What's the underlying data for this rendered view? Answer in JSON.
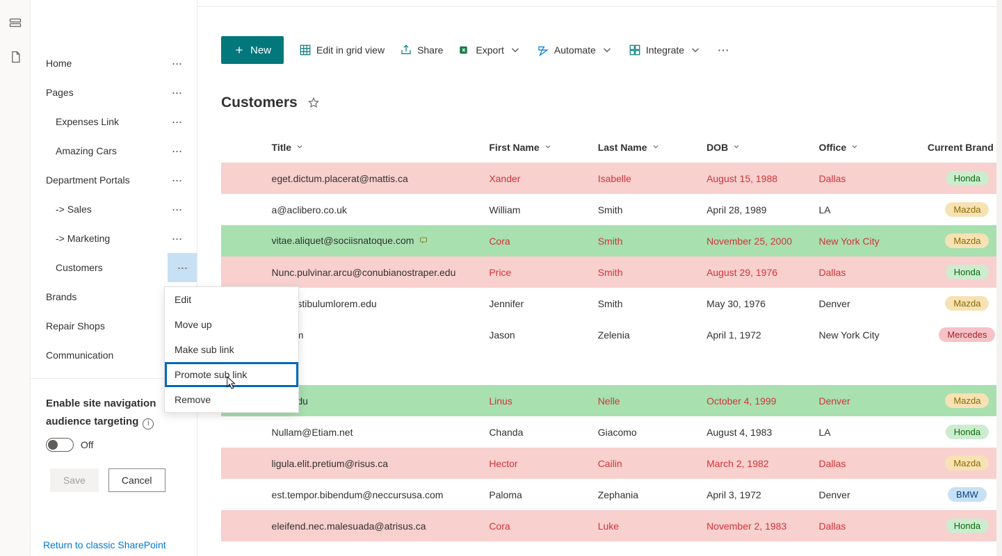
{
  "rail": {
    "icon1": "card-icon",
    "icon2": "file-icon"
  },
  "sidebar": {
    "items": [
      {
        "label": "Home",
        "sub": false,
        "dots": true
      },
      {
        "label": "Pages",
        "sub": false,
        "dots": true
      },
      {
        "label": "Expenses Link",
        "sub": true,
        "dots": true
      },
      {
        "label": "Amazing Cars",
        "sub": true,
        "dots": true
      },
      {
        "label": "Department Portals",
        "sub": false,
        "dots": true
      },
      {
        "label": "-> Sales",
        "sub": true,
        "dots": true
      },
      {
        "label": "-> Marketing",
        "sub": true,
        "dots": true
      },
      {
        "label": "Customers",
        "sub": true,
        "dots": true,
        "active": true
      },
      {
        "label": "Brands",
        "sub": false,
        "dots": false
      },
      {
        "label": "Repair Shops",
        "sub": false,
        "dots": false
      },
      {
        "label": "Communication",
        "sub": false,
        "dots": false
      }
    ],
    "audience_label_line1": "Enable site navigation",
    "audience_label_line2": "audience targeting",
    "toggle_state": "Off",
    "save_label": "Save",
    "cancel_label": "Cancel",
    "classic_link": "Return to classic SharePoint"
  },
  "context_menu": {
    "items": [
      "Edit",
      "Move up",
      "Make sub link",
      "Promote sub link",
      "Remove"
    ],
    "highlighted_index": 3
  },
  "command_bar": {
    "new": "New",
    "grid": "Edit in grid view",
    "share": "Share",
    "export": "Export",
    "automate": "Automate",
    "integrate": "Integrate"
  },
  "page_title": "Customers",
  "columns": [
    "Title",
    "First Name",
    "Last Name",
    "DOB",
    "Office",
    "Current Brand"
  ],
  "rows": [
    {
      "style": "pink",
      "hl": true,
      "title": "eget.dictum.placerat@mattis.ca",
      "first": "Xander",
      "last": "Isabelle",
      "dob": "August 15, 1988",
      "office": "Dallas",
      "brand": "Honda",
      "brandClass": "honda"
    },
    {
      "style": "",
      "hl": false,
      "title": "a@aclibero.co.uk",
      "first": "William",
      "last": "Smith",
      "dob": "April 28, 1989",
      "office": "LA",
      "brand": "Mazda",
      "brandClass": "mazda"
    },
    {
      "style": "green",
      "hl": true,
      "title": "vitae.aliquet@sociisnatoque.com",
      "comment": true,
      "first": "Cora",
      "last": "Smith",
      "dob": "November 25, 2000",
      "office": "New York City",
      "brand": "Mazda",
      "brandClass": "mazda"
    },
    {
      "style": "pink",
      "hl": true,
      "title": "Nunc.pulvinar.arcu@conubianostraper.edu",
      "first": "Price",
      "last": "Smith",
      "dob": "August 29, 1976",
      "office": "Dallas",
      "brand": "Honda",
      "brandClass": "honda"
    },
    {
      "style": "",
      "hl": false,
      "title": "e@vestibulumlorem.edu",
      "first": "Jennifer",
      "last": "Smith",
      "dob": "May 30, 1976",
      "office": "Denver",
      "brand": "Mazda",
      "brandClass": "mazda",
      "truncLeft": true
    },
    {
      "style": "",
      "hl": false,
      "title": "on.com",
      "first": "Jason",
      "last": "Zelenia",
      "dob": "April 1, 1972",
      "office": "New York City",
      "brand": "Mercedes",
      "brandClass": "mercedes",
      "truncLeft": true
    },
    {
      "style": "gap"
    },
    {
      "style": "green",
      "hl": true,
      "title": "@in.edu",
      "first": "Linus",
      "last": "Nelle",
      "dob": "October 4, 1999",
      "office": "Denver",
      "brand": "Mazda",
      "brandClass": "mazda",
      "truncLeft": true
    },
    {
      "style": "",
      "hl": false,
      "title": "Nullam@Etiam.net",
      "first": "Chanda",
      "last": "Giacomo",
      "dob": "August 4, 1983",
      "office": "LA",
      "brand": "Honda",
      "brandClass": "honda"
    },
    {
      "style": "pink",
      "hl": true,
      "title": "ligula.elit.pretium@risus.ca",
      "first": "Hector",
      "last": "Cailin",
      "dob": "March 2, 1982",
      "office": "Dallas",
      "brand": "Mazda",
      "brandClass": "mazda"
    },
    {
      "style": "",
      "hl": false,
      "title": "est.tempor.bibendum@neccursusa.com",
      "first": "Paloma",
      "last": "Zephania",
      "dob": "April 3, 1972",
      "office": "Denver",
      "brand": "BMW",
      "brandClass": "bmw"
    },
    {
      "style": "pink",
      "hl": true,
      "title": "eleifend.nec.malesuada@atrisus.ca",
      "first": "Cora",
      "last": "Luke",
      "dob": "November 2, 1983",
      "office": "Dallas",
      "brand": "Honda",
      "brandClass": "honda"
    }
  ]
}
